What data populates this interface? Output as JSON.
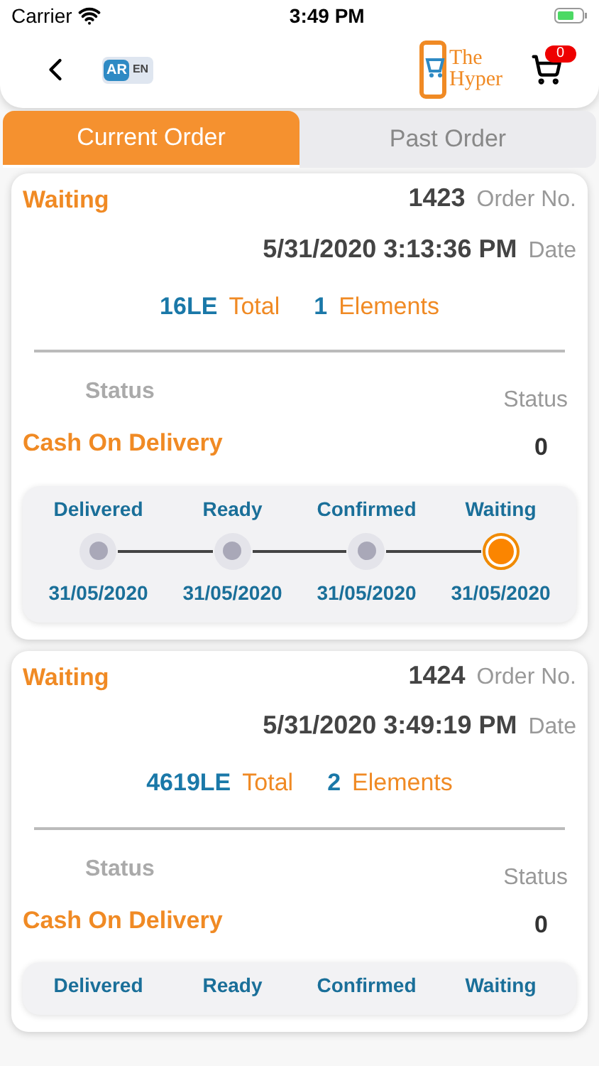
{
  "status_bar": {
    "carrier": "Carrier",
    "time": "3:49 PM"
  },
  "header": {
    "language_badge": [
      "AR",
      "EN"
    ],
    "logo_text": [
      "The",
      "Hyper"
    ],
    "cart_count": "0"
  },
  "tabs": [
    {
      "label": "Current Order",
      "selected": true
    },
    {
      "label": "Past Order",
      "selected": false
    }
  ],
  "orders": [
    {
      "status": "Waiting",
      "order_number": "1423",
      "order_label": "Order No.",
      "date": "5/31/2020 3:13:36 PM",
      "date_label": "Date",
      "total": "16LE",
      "total_label": "Total",
      "elements": "1",
      "elements_label": "Elements",
      "status_heading": "Status",
      "status_label": "Status",
      "payment": "Cash On Delivery",
      "payment_value": "0",
      "steps": [
        {
          "label": "Delivered",
          "date": "31/05/2020",
          "selected": false
        },
        {
          "label": "Ready",
          "date": "31/05/2020",
          "selected": false
        },
        {
          "label": "Confirmed",
          "date": "31/05/2020",
          "selected": false
        },
        {
          "label": "Waiting",
          "date": "31/05/2020",
          "selected": true
        }
      ]
    },
    {
      "status": "Waiting",
      "order_number": "1424",
      "order_label": "Order No.",
      "date": "5/31/2020 3:49:19 PM",
      "date_label": "Date",
      "total": "4619LE",
      "total_label": "Total",
      "elements": "2",
      "elements_label": "Elements",
      "status_heading": "Status",
      "status_label": "Status",
      "payment": "Cash On Delivery",
      "payment_value": "0",
      "steps": [
        {
          "label": "Delivered"
        },
        {
          "label": "Ready"
        },
        {
          "label": "Confirmed"
        },
        {
          "label": "Waiting"
        }
      ]
    }
  ]
}
